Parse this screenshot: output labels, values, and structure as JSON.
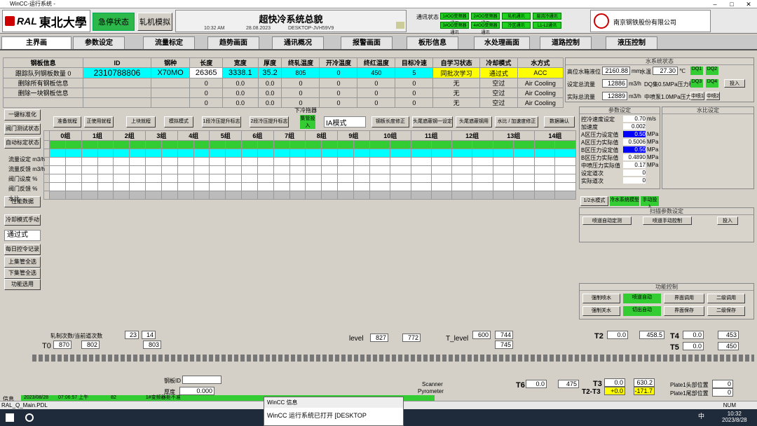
{
  "window": {
    "title": "WinCC-运行系统 -"
  },
  "header": {
    "logo_ral": "RAL",
    "logo_cn": "東北大學",
    "emergency": "急停状态",
    "roll_sim": "轧机模拟",
    "title": "超快冷系统总貌",
    "time": "10:32 AM",
    "date": "28.08.2023",
    "host": "DESKTOP-JVH59V9",
    "comm_label": "通讯状态",
    "comm": [
      "1#OO变频器通讯",
      "2#OO变频器通讯",
      "轧机通讯",
      "层流冷通讯",
      "3#OO变频器通讯",
      "4#OO变频器通讯",
      "冷区通讯",
      "L1-L2通讯"
    ],
    "company": "南京钢铁股份有限公司"
  },
  "tabs": [
    "主界画",
    "参数设定",
    "流量标定",
    "趋势画面",
    "通讯概况",
    "报警画面",
    "板形信息",
    "水处理画面",
    "道路控制",
    "液压控制"
  ],
  "coil": {
    "headers": [
      "钢板信息",
      "ID",
      "钢种",
      "长度",
      "宽度",
      "厚度",
      "终轧温度",
      "开冷温度",
      "终红温度",
      "目标冷速",
      "自学习状态",
      "冷却模式",
      "水方式"
    ],
    "rows": [
      [
        "跟踪队列钢板数量 0",
        "2310788806",
        "X70MO",
        "26365",
        "3338.1",
        "35.2",
        "805",
        "0",
        "450",
        "5",
        "同批次学习",
        "通过式",
        "ACC"
      ],
      [
        "删除所有钢板信息",
        "",
        "",
        "0",
        "0.0",
        "0.0",
        "0",
        "0",
        "0",
        "0",
        "无",
        "空过",
        "Air Cooling"
      ],
      [
        "删除一块钢板信息",
        "",
        "",
        "0",
        "0.0",
        "0.0",
        "0",
        "0",
        "0",
        "0",
        "无",
        "空过",
        "Air Cooling"
      ],
      [
        "",
        "",
        "",
        "0",
        "0.0",
        "0.0",
        "0",
        "0",
        "0",
        "0",
        "无",
        "空过",
        "Air Cooling"
      ]
    ]
  },
  "water": {
    "title": "水系统状态",
    "level_label": "高位水箱液位",
    "level": "2160.88",
    "level_unit": "mm",
    "temp_label": "水温",
    "temp": "27.30",
    "temp_unit": "℃",
    "set_flow_label": "设定总流量",
    "set_flow": "12886",
    "set_flow_unit": "m3/h",
    "set_flow_status": "DQ集0.5MPa压力稳定",
    "act_flow_label": "实际总流量",
    "act_flow": "12889",
    "act_flow_unit": "m3/h",
    "act_flow_status": "中喷泵1.0MPa压力稳定",
    "dq": [
      "DQ1",
      "DQ2",
      "DQ3",
      "DQ4"
    ],
    "pumps": [
      "中喷1",
      "中喷2"
    ],
    "enable": "投入"
  },
  "side_buttons": [
    "一键标准化",
    "阀门测试状态",
    "自动标定状态",
    "性能数据",
    "冷却模式手动",
    "通过式",
    "每日控令记录",
    "上集管全选",
    "下集管全选",
    "功能选用"
  ],
  "mid": {
    "title": "下冷拖器",
    "buttons": [
      "准备就程",
      "正使用就程",
      "上块就程",
      "模拟模式",
      "1段冷压提升标志",
      "2段冷压提升标志",
      "集管投入",
      "钢板长度修正",
      "头尾遮蔽钢一设定",
      "头尾遮蔽钢用",
      "水比 / 加速度修正",
      "数据确认"
    ],
    "mode": "IA模式",
    "banks": [
      "0组",
      "1组",
      "2组",
      "3组",
      "4组",
      "5组",
      "6组",
      "7组",
      "8组",
      "9组",
      "10组",
      "11组",
      "12组",
      "13组",
      "14组"
    ],
    "row_labels": [
      "流量设定 m3/h",
      "流量反馈 m3/h",
      "阀门设度 %",
      "阀门反馈 %",
      "水比"
    ]
  },
  "params": {
    "title": "参数设定",
    "items": [
      {
        "label": "控冷速度设定",
        "value": "0.70",
        "unit": "m/s"
      },
      {
        "label": "加速度",
        "value": "0.002",
        "unit": ""
      },
      {
        "label": "A区压力设定值",
        "value": "0.50",
        "unit": "MPa"
      },
      {
        "label": "A区压力实际值",
        "value": "0.5006",
        "unit": "MPa"
      },
      {
        "label": "B区压力设定值",
        "value": "0.50",
        "unit": "MPa"
      },
      {
        "label": "B区压力实际值",
        "value": "0.4890",
        "unit": "MPa"
      },
      {
        "label": "中喷压力实际值",
        "value": "0.17",
        "unit": "MPa"
      },
      {
        "label": "设定道次",
        "value": "0",
        "unit": ""
      },
      {
        "label": "实际道次",
        "value": "0",
        "unit": ""
      }
    ],
    "water_title": "水比设定",
    "mode_btns": [
      "1/2水模式",
      "冷水系统模型",
      "手动投入"
    ],
    "scan_title": "扫描参数设定",
    "scan_btns": [
      "喷道自动定测",
      "喷道手动控制",
      "投入"
    ],
    "func_title": "功能控制",
    "func_btns": [
      "强制喷水",
      "喷道自动",
      "界面调用",
      "二级调用",
      "强制关水",
      "切出自动",
      "界面保存",
      "二级保存"
    ]
  },
  "bottom": {
    "level_label": "level",
    "level1": "827",
    "level2": "772",
    "t_level_label": "T_level",
    "t_level": "600",
    "t_level2": "744",
    "t_level3": "745",
    "t2_label": "T2",
    "t2": "0.0",
    "t2b": "458.5",
    "t4_label": "T4",
    "t4": "0.0",
    "t4b": "453",
    "t5_label": "T5",
    "t5": "0.0",
    "t5b": "450",
    "t0_label": "T0",
    "t0": "870",
    "t0b": "802",
    "t1b": "803",
    "scanner": "Scanner",
    "pyrometer": "Pyrometer",
    "t6_label": "T6",
    "t6": "0.0",
    "t6b": "475",
    "t3_label": "T3",
    "t3": "0.0",
    "t3b": "630.2",
    "t23_label": "T2-T3",
    "t23": "+0.0",
    "t23b": "-171.7",
    "plate1": "Plate1头部位置",
    "plate1v": "0",
    "plate2": "Plate1尾部位置",
    "plate2v": "0",
    "steel_label": "钢板ID",
    "thick_label": "厚度",
    "thick": "0.000",
    "coef_label": "轧制次数/当前道次数",
    "coef1": "23",
    "coef2": "14",
    "info_label": "信息",
    "info_date": "2023/08/28",
    "info_time": "07:06:57 上午",
    "info_code": "82",
    "info_text": "1#变频器拒不准"
  },
  "statusbar": {
    "left": "RAL_Q_Main.PDL",
    "right": "NUM"
  },
  "taskbar": {
    "popup_title": "WinCC 信息",
    "popup_text": "WinCC 运行系统已打开 [DESKTOP",
    "time": "10:32",
    "date": "2023/8/28",
    "lang": "中"
  }
}
